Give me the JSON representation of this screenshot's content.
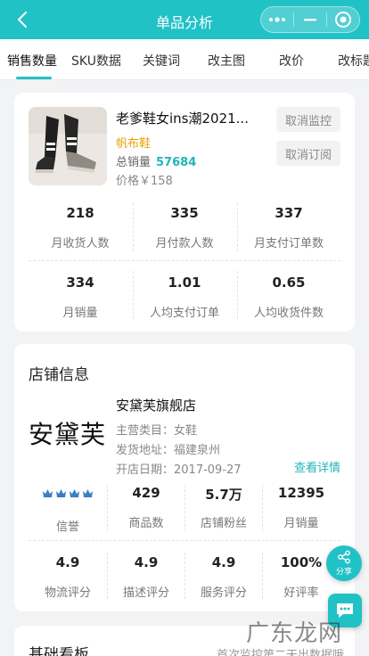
{
  "nav": {
    "title": "单品分析"
  },
  "tabs": [
    "销售数量",
    "SKU数据",
    "关键词",
    "改主图",
    "改价",
    "改标题"
  ],
  "product": {
    "title": "老爹鞋女ins潮2021...",
    "tag": "帆布鞋",
    "sales_label": "总销量",
    "sales_value": "57684",
    "price": "价格￥158",
    "btn_cancel_monitor": "取消监控",
    "btn_cancel_subscribe": "取消订阅"
  },
  "metrics": [
    {
      "value": "218",
      "label": "月收货人数"
    },
    {
      "value": "335",
      "label": "月付款人数"
    },
    {
      "value": "337",
      "label": "月支付订单数"
    },
    {
      "value": "334",
      "label": "月销量"
    },
    {
      "value": "1.01",
      "label": "人均支付订单"
    },
    {
      "value": "0.65",
      "label": "人均收货件数"
    }
  ],
  "shop": {
    "section_title": "店铺信息",
    "logo_text": "安黛芙",
    "name": "安黛芙旗舰店",
    "category": "主营类目：女鞋",
    "address": "发货地址：福建泉州",
    "open_date": "开店日期：2017-09-27",
    "detail_link": "查看详情",
    "reputation": {
      "label": "信誉",
      "icon": "crown-icon",
      "count": 4
    },
    "stats": [
      {
        "value": "429",
        "label": "商品数"
      },
      {
        "value": "5.7万",
        "label": "店铺粉丝"
      },
      {
        "value": "12395",
        "label": "月销量"
      }
    ],
    "scores": [
      {
        "value": "4.9",
        "label": "物流评分"
      },
      {
        "value": "4.9",
        "label": "描述评分"
      },
      {
        "value": "4.9",
        "label": "服务评分"
      },
      {
        "value": "100%",
        "label": "好评率"
      }
    ]
  },
  "fab": {
    "share_label": "分享"
  },
  "base": {
    "title": "基础看板",
    "note": "首次监控第二天出数据哦"
  },
  "watermark": "广东龙网",
  "colors": {
    "primary": "#20c2c6",
    "tag": "#e6a400",
    "link": "#20b6ba"
  }
}
